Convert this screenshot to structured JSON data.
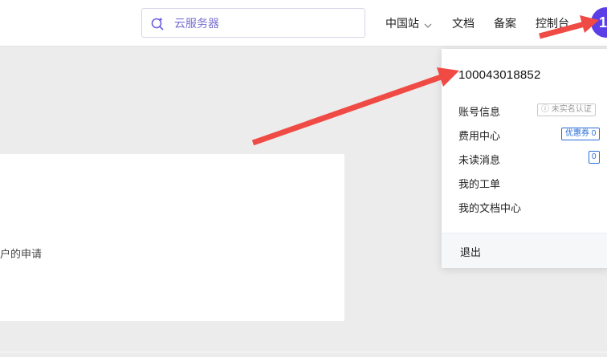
{
  "header": {
    "search": {
      "placeholder": "云服务器",
      "value": ""
    },
    "nav": [
      {
        "label": "中国站"
      },
      {
        "label": "文档"
      },
      {
        "label": "备案"
      },
      {
        "label": "控制台"
      }
    ],
    "avatar_text": "1"
  },
  "card": {
    "text": "客户的申请"
  },
  "user_menu": {
    "account_id": "100043018852",
    "items": [
      {
        "label": "账号信息",
        "badge": "未实名认证"
      },
      {
        "label": "费用中心",
        "badge": "优惠券 0"
      },
      {
        "label": "未读消息",
        "badge": "0"
      },
      {
        "label": "我的工单"
      },
      {
        "label": "我的文档中心"
      }
    ],
    "logout": "退出"
  },
  "annotations": {
    "arrow_color": "#f04a45"
  },
  "colors": {
    "accent": "#5b3ee6",
    "link_blue": "#2a6ed6"
  },
  "icons": [
    "search-sparkle-icon",
    "chevron-down-icon",
    "info-circle-icon"
  ]
}
